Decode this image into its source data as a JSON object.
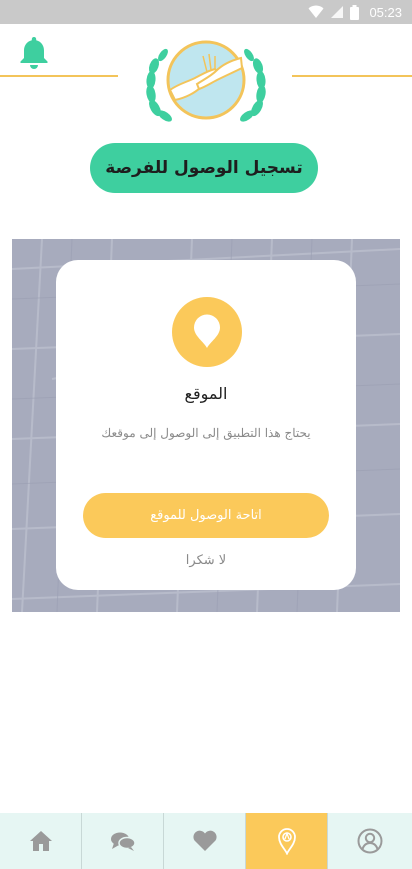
{
  "status_bar": {
    "time": "05:23"
  },
  "header": {
    "title": "تسجيل الوصول للفرصة"
  },
  "modal": {
    "title": "الموقع",
    "message": "يحتاج هذا التطبيق إلى الوصول إلى موقعك",
    "allow_label": "اتاحة الوصول للموقع",
    "deny_label": "لا شكرا"
  },
  "tabs": [
    {
      "name": "home",
      "icon": "home-icon",
      "active": false
    },
    {
      "name": "chat",
      "icon": "chat-icon",
      "active": false
    },
    {
      "name": "favorites",
      "icon": "heart-icon",
      "active": false
    },
    {
      "name": "location",
      "icon": "location-pin-icon",
      "active": true
    },
    {
      "name": "profile",
      "icon": "profile-icon",
      "active": false
    }
  ],
  "colors": {
    "accent_green": "#3ecf9f",
    "accent_yellow": "#fbc95a",
    "gold_line": "#f3c45a",
    "tab_bg": "#e6f6f3",
    "map_bg": "#a7abbd"
  }
}
